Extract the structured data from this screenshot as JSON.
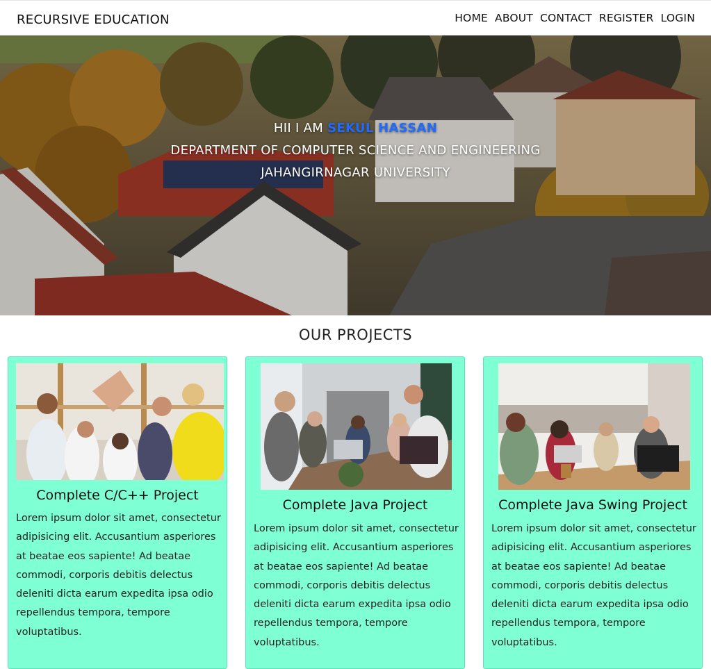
{
  "navbar": {
    "brand": "RECURSIVE EDUCATION",
    "links": [
      "HOME",
      "ABOUT",
      "CONTACT",
      "REGISTER",
      "LOGIN"
    ]
  },
  "hero": {
    "greeting": "HII I AM",
    "name": "SEKUL HASSAN",
    "department": "DEPARTMENT OF COMPUTER SCIENCE AND ENGINEERING",
    "university": "JAHANGIRNAGAR UNIVERSITY"
  },
  "projects": {
    "title": "OUR PROJECTS",
    "cards": [
      {
        "title": "Complete C/C++ Project",
        "text": "Lorem ipsum dolor sit amet, consectetur adipisicing elit. Accusantium asperiores at beatae eos sapiente! Ad beatae commodi, corporis debitis delectus deleniti dicta earum expedita ipsa odio repellendus tempora, tempore voluptatibus."
      },
      {
        "title": "Complete Java Project",
        "text": "Lorem ipsum dolor sit amet, consectetur adipisicing elit. Accusantium asperiores at beatae eos sapiente! Ad beatae commodi, corporis debitis delectus deleniti dicta earum expedita ipsa odio repellendus tempora, tempore voluptatibus."
      },
      {
        "title": "Complete Java Swing Project",
        "text": "Lorem ipsum dolor sit amet, consectetur adipisicing elit. Accusantium asperiores at beatae eos sapiente! Ad beatae commodi, corporis debitis delectus deleniti dicta earum expedita ipsa odio repellendus tempora, tempore voluptatibus."
      }
    ]
  },
  "colors": {
    "card_background": "#7fffd4",
    "name_accent": "#1f6bff"
  }
}
